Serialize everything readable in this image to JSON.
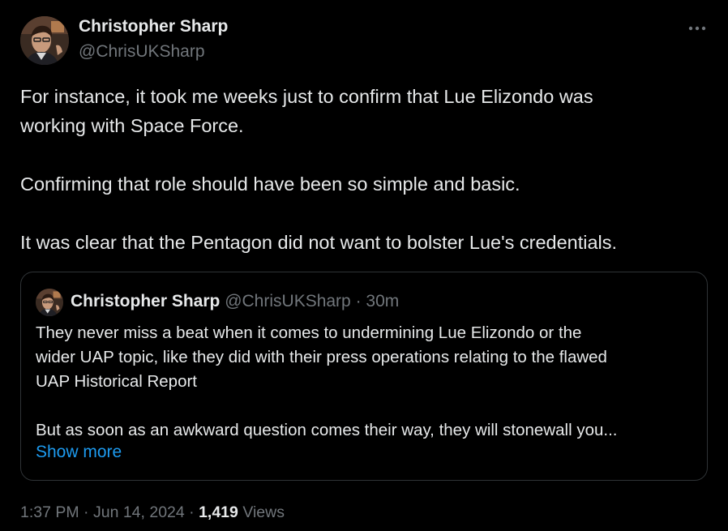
{
  "author": {
    "name": "Christopher Sharp",
    "handle": "@ChrisUKSharp"
  },
  "icons": {
    "more": "more-horizontal-icon"
  },
  "tweet_lines": [
    "For instance, it took me weeks just to confirm that Lue Elizondo was",
    "working with Space Force.",
    "Confirming that role should have been so simple and basic.",
    "It was clear that the Pentagon did not want to bolster Lue's credentials."
  ],
  "quoted_tweet": {
    "name": "Christopher Sharp",
    "handle": "@ChrisUKSharp",
    "separator": "·",
    "time": "30m",
    "lines": [
      "They never miss a beat when it comes to undermining Lue Elizondo or the",
      "wider UAP topic, like they did with their press operations relating to the flawed",
      "UAP Historical Report",
      "But as soon as an awkward question comes their way, they will stonewall you..."
    ],
    "show_more_label": "Show more"
  },
  "meta": {
    "time": "1:37 PM",
    "separator": "·",
    "date": "Jun 14, 2024",
    "views_count": "1,419",
    "views_label": "Views"
  },
  "colors": {
    "background": "#000000",
    "text_primary": "#e7e9ea",
    "text_secondary": "#71767b",
    "link": "#1d9bf0",
    "border": "#2f3336"
  }
}
